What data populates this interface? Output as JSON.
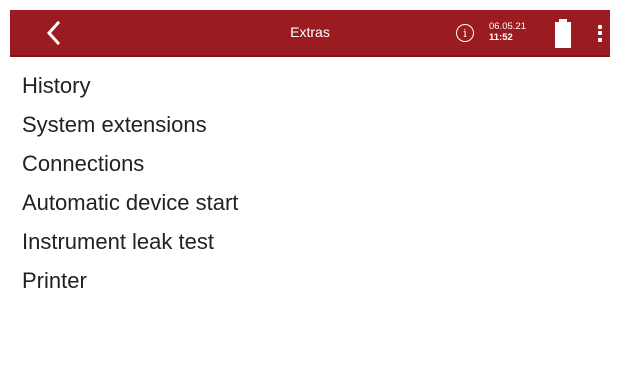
{
  "header": {
    "back_icon": "chevron-left-icon",
    "title": "Extras",
    "info_icon": "info-circle-icon",
    "info_glyph": "i",
    "date": "06.05.21",
    "time": "11:52",
    "battery_icon": "battery-full-icon",
    "battery_level": 1.0,
    "more_icon": "more-vertical-icon",
    "background_color": "#9b1c20"
  },
  "menu": {
    "items": [
      {
        "label": "History"
      },
      {
        "label": "System extensions"
      },
      {
        "label": "Connections"
      },
      {
        "label": "Automatic device start"
      },
      {
        "label": "Instrument leak test"
      },
      {
        "label": "Printer"
      }
    ]
  }
}
